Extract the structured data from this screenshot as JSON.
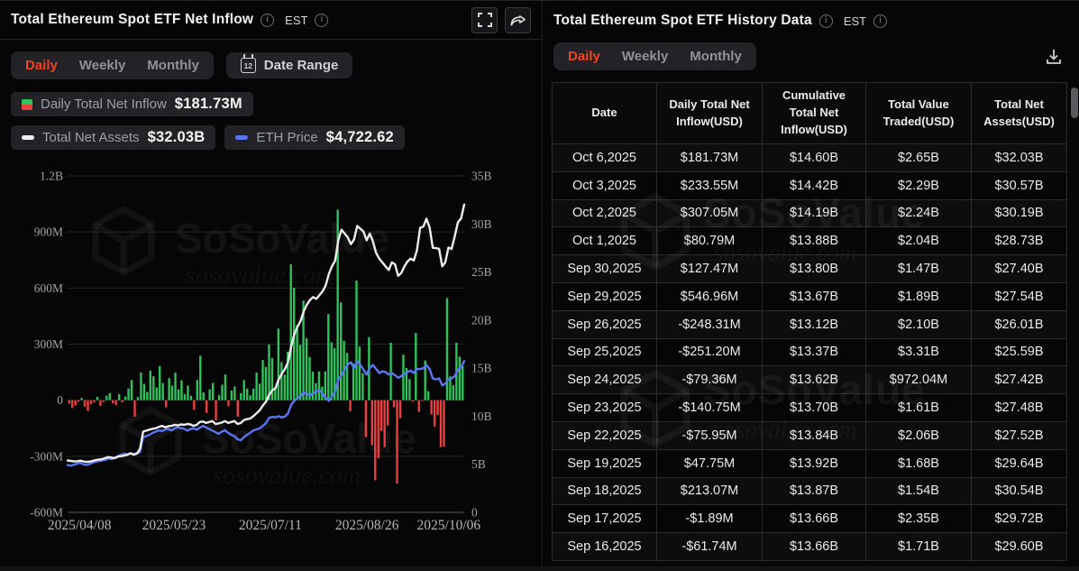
{
  "colors": {
    "accent_red": "#ee4224",
    "positive_green": "#2fc45a",
    "negative_red": "#ef3f3f",
    "eth_line_blue": "#5b76f5",
    "net_assets_line_white": "#ededed",
    "panel_bg": "#060607",
    "badge_bg": "#232327"
  },
  "icons": [
    "info-icon",
    "fullscreen-icon",
    "share-icon",
    "calendar-icon",
    "download-icon",
    "cube-logo-icon"
  ],
  "watermark": {
    "brand": "SoSoValue",
    "domain": "sosovalue.com"
  },
  "left_panel": {
    "title": "Total Ethereum Spot ETF Net Inflow",
    "timezone": "EST",
    "tabs": [
      "Daily",
      "Weekly",
      "Monthly"
    ],
    "active_tab": "Daily",
    "date_range_label": "Date Range",
    "calendar_day": "12",
    "legend": [
      {
        "label": "Daily Total Net Inflow",
        "value": "$181.73M"
      },
      {
        "label": "Total Net Assets",
        "value": "$32.03B"
      },
      {
        "label": "ETH Price",
        "value": "$4,722.62"
      }
    ]
  },
  "chart_data": {
    "type": "bar",
    "title": "Total Ethereum Spot ETF Net Inflow",
    "left_axis": {
      "unit": "USD millions",
      "max": 1200,
      "min": -600,
      "ticks": [
        [
          "1.2B",
          1200
        ],
        [
          "900M",
          900
        ],
        [
          "600M",
          600
        ],
        [
          "300M",
          300
        ],
        [
          "0",
          0
        ],
        [
          "-300M",
          -300
        ],
        [
          "-600M",
          -600
        ]
      ]
    },
    "right_axis": {
      "unit": "USD billions",
      "max": 35,
      "min": 0,
      "ticks": [
        [
          "35B",
          35
        ],
        [
          "30B",
          30
        ],
        [
          "25B",
          25
        ],
        [
          "20B",
          20
        ],
        [
          "15B",
          15
        ],
        [
          "10B",
          10
        ],
        [
          "5B",
          5
        ],
        [
          "0",
          0
        ]
      ]
    },
    "x_ticks": [
      [
        "2025/04/08",
        0.03
      ],
      [
        "2025/05/23",
        0.268
      ],
      [
        "2025/07/11",
        0.511
      ],
      [
        "2025/08/26",
        0.755
      ],
      [
        "2025/10/06",
        0.961
      ]
    ],
    "grid": true,
    "legend_position": "top-left",
    "series": [
      {
        "name": "Daily Total Net Inflow",
        "type": "bar",
        "axis": "left",
        "unit": "USD millions",
        "values": [
          -18,
          -42,
          -28,
          -8,
          12,
          -34,
          -58,
          -22,
          -12,
          18,
          -30,
          -10,
          24,
          38,
          -16,
          -26,
          33,
          -12,
          20,
          63,
          108,
          -88,
          17,
          148,
          88,
          44,
          158,
          128,
          68,
          182,
          92,
          -38,
          118,
          78,
          147,
          58,
          107,
          33,
          78,
          24,
          -52,
          108,
          238,
          42,
          -68,
          58,
          92,
          -108,
          28,
          83,
          138,
          -32,
          52,
          73,
          -88,
          38,
          108,
          62,
          26,
          62,
          148,
          88,
          215,
          178,
          298,
          226,
          64,
          383,
          204,
          137,
          259,
          727,
          602,
          402,
          296,
          533,
          332,
          231,
          152,
          91,
          154,
          73,
          154,
          461,
          310,
          278,
          1019,
          523,
          318,
          253,
          -59,
          196,
          640,
          287,
          145,
          -197,
          337,
          -240,
          -428,
          -310,
          -165,
          -251,
          -135,
          307,
          -38,
          -446,
          -96,
          244,
          172,
          113,
          -7,
          360,
          -61.74,
          -1.89,
          213.07,
          47.75,
          -75.95,
          -140.75,
          -79.36,
          -251.2,
          -248.31,
          546.96,
          127.47,
          80.79,
          307.05,
          233.55,
          181.73
        ]
      },
      {
        "name": "Total Net Assets",
        "type": "line",
        "axis": "right",
        "unit": "USD billions",
        "current": "$32.03B",
        "values": [
          5.4,
          5.35,
          5.3,
          5.32,
          5.38,
          5.3,
          5.25,
          5.28,
          5.35,
          5.45,
          5.5,
          5.55,
          5.65,
          5.75,
          5.7,
          5.65,
          5.8,
          5.85,
          5.9,
          6.0,
          6.15,
          6.0,
          6.1,
          6.6,
          8.4,
          8.5,
          8.6,
          8.7,
          8.75,
          8.9,
          9.0,
          8.85,
          8.95,
          9.0,
          9.1,
          9.05,
          9.15,
          9.1,
          9.2,
          9.15,
          9.0,
          9.1,
          9.4,
          9.45,
          9.3,
          9.4,
          9.5,
          9.2,
          9.25,
          9.35,
          9.5,
          9.3,
          9.4,
          9.5,
          9.2,
          9.3,
          9.6,
          9.7,
          9.75,
          10.0,
          10.3,
          10.6,
          11.1,
          11.5,
          12.2,
          12.7,
          12.9,
          13.8,
          14.4,
          14.9,
          15.6,
          17.2,
          18.5,
          19.3,
          19.9,
          20.9,
          21.6,
          22.1,
          22.4,
          22.2,
          22.6,
          23.0,
          23.6,
          24.8,
          25.6,
          26.2,
          28.3,
          29.4,
          29.0,
          28.6,
          27.9,
          28.4,
          29.8,
          29.5,
          29.2,
          28.3,
          29.0,
          28.2,
          27.0,
          26.4,
          26.0,
          25.6,
          25.2,
          26.0,
          25.8,
          24.6,
          24.9,
          25.6,
          26.1,
          26.4,
          26.2,
          27.3,
          29.6,
          29.72,
          30.54,
          29.64,
          27.52,
          27.48,
          27.42,
          25.59,
          26.01,
          27.54,
          27.4,
          28.73,
          30.19,
          30.57,
          32.03
        ]
      },
      {
        "name": "ETH Price",
        "type": "line",
        "axis": "right",
        "unit": "USD",
        "plot_divisor": 300,
        "current": "$4,722.62",
        "values": [
          1475,
          1460,
          1490,
          1520,
          1545,
          1500,
          1480,
          1510,
          1555,
          1585,
          1600,
          1620,
          1640,
          1680,
          1660,
          1700,
          1760,
          1800,
          1830,
          1810,
          1840,
          1820,
          1850,
          1880,
          2350,
          2380,
          2420,
          2480,
          2520,
          2560,
          2540,
          2580,
          2600,
          2560,
          2620,
          2650,
          2630,
          2610,
          2550,
          2600,
          2620,
          2580,
          2640,
          2700,
          2650,
          2600,
          2550,
          2500,
          2450,
          2520,
          2560,
          2480,
          2420,
          2380,
          2280,
          2250,
          2350,
          2420,
          2480,
          2560,
          2590,
          2620,
          2700,
          2780,
          2950,
          2980,
          2960,
          3000,
          2960,
          2990,
          3080,
          3350,
          3480,
          3560,
          3620,
          3740,
          3700,
          3650,
          3720,
          3780,
          3820,
          3700,
          3580,
          3480,
          3620,
          3780,
          4150,
          4280,
          4450,
          4620,
          4680,
          4500,
          4720,
          4600,
          4450,
          4300,
          4500,
          4600,
          4480,
          4350,
          4400,
          4380,
          4300,
          4350,
          4280,
          4200,
          4250,
          4320,
          4380,
          4420,
          4350,
          4480,
          4470,
          4500,
          4590,
          4480,
          4180,
          4150,
          4180,
          3960,
          4020,
          4150,
          4180,
          4250,
          4450,
          4520,
          4722
        ]
      }
    ]
  },
  "right_panel": {
    "title": "Total Ethereum Spot ETF History Data",
    "timezone": "EST",
    "tabs": [
      "Daily",
      "Weekly",
      "Monthly"
    ],
    "active_tab": "Daily",
    "table": {
      "columns": [
        "Date",
        "Daily Total Net Inflow(USD)",
        "Cumulative Total Net Inflow(USD)",
        "Total Value Traded(USD)",
        "Total Net Assets(USD)"
      ],
      "rows": [
        [
          "Oct 6,2025",
          "$181.73M",
          "$14.60B",
          "$2.65B",
          "$32.03B"
        ],
        [
          "Oct 3,2025",
          "$233.55M",
          "$14.42B",
          "$2.29B",
          "$30.57B"
        ],
        [
          "Oct 2,2025",
          "$307.05M",
          "$14.19B",
          "$2.24B",
          "$30.19B"
        ],
        [
          "Oct 1,2025",
          "$80.79M",
          "$13.88B",
          "$2.04B",
          "$28.73B"
        ],
        [
          "Sep 30,2025",
          "$127.47M",
          "$13.80B",
          "$1.47B",
          "$27.40B"
        ],
        [
          "Sep 29,2025",
          "$546.96M",
          "$13.67B",
          "$1.89B",
          "$27.54B"
        ],
        [
          "Sep 26,2025",
          "-$248.31M",
          "$13.12B",
          "$2.10B",
          "$26.01B"
        ],
        [
          "Sep 25,2025",
          "-$251.20M",
          "$13.37B",
          "$3.31B",
          "$25.59B"
        ],
        [
          "Sep 24,2025",
          "-$79.36M",
          "$13.62B",
          "$972.04M",
          "$27.42B"
        ],
        [
          "Sep 23,2025",
          "-$140.75M",
          "$13.70B",
          "$1.61B",
          "$27.48B"
        ],
        [
          "Sep 22,2025",
          "-$75.95M",
          "$13.84B",
          "$2.06B",
          "$27.52B"
        ],
        [
          "Sep 19,2025",
          "$47.75M",
          "$13.92B",
          "$1.68B",
          "$29.64B"
        ],
        [
          "Sep 18,2025",
          "$213.07M",
          "$13.87B",
          "$1.54B",
          "$30.54B"
        ],
        [
          "Sep 17,2025",
          "-$1.89M",
          "$13.66B",
          "$2.35B",
          "$29.72B"
        ],
        [
          "Sep 16,2025",
          "-$61.74M",
          "$13.66B",
          "$1.71B",
          "$29.60B"
        ]
      ]
    }
  }
}
